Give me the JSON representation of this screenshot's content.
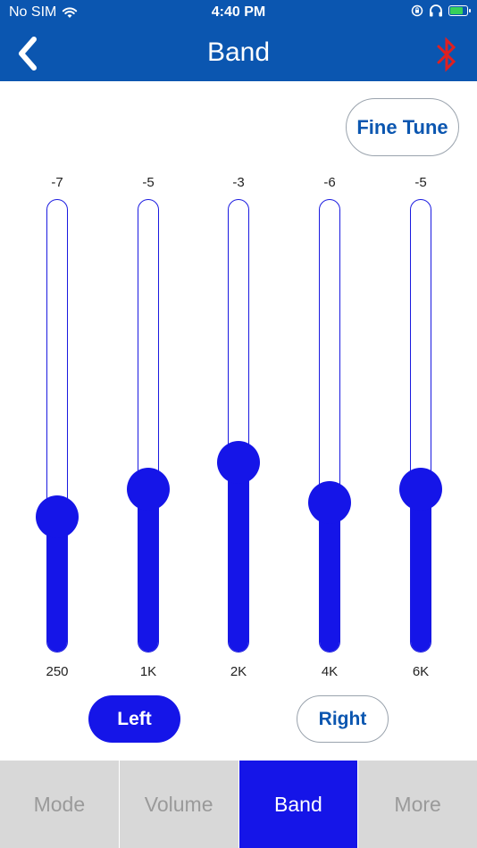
{
  "status_bar": {
    "carrier": "No SIM",
    "time": "4:40 PM"
  },
  "nav": {
    "title": "Band",
    "back_icon": "chevron-left-icon",
    "bluetooth_icon": "bluetooth-icon",
    "bluetooth_color": "#e02020"
  },
  "fine_tune_label": "Fine Tune",
  "equalizer": {
    "bands": [
      {
        "label": "250",
        "value": "-7",
        "level": 0.3
      },
      {
        "label": "1K",
        "value": "-5",
        "level": 0.36
      },
      {
        "label": "2K",
        "value": "-3",
        "level": 0.42
      },
      {
        "label": "4K",
        "value": "-6",
        "level": 0.33
      },
      {
        "label": "6K",
        "value": "-5",
        "level": 0.36
      }
    ]
  },
  "side_toggle": {
    "left_label": "Left",
    "right_label": "Right",
    "selected": "Left"
  },
  "tabs": [
    {
      "label": "Mode",
      "active": false
    },
    {
      "label": "Volume",
      "active": false
    },
    {
      "label": "Band",
      "active": true
    },
    {
      "label": "More",
      "active": false
    }
  ],
  "colors": {
    "header": "#0b56b0",
    "accent": "#1515e8",
    "tab_inactive": "#d8d8d8"
  }
}
